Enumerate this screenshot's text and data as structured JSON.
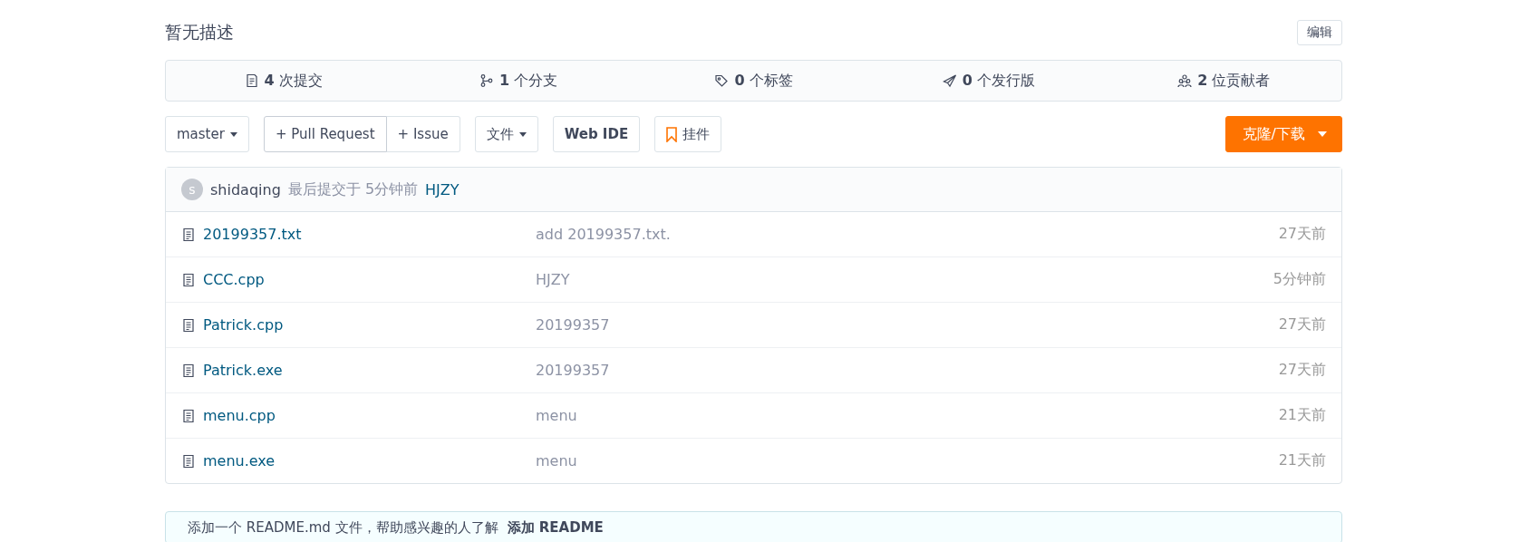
{
  "description": "暂无描述",
  "edit_button": "编辑",
  "stats": [
    {
      "kind": "commits",
      "count": "4",
      "label": "次提交"
    },
    {
      "kind": "branches",
      "count": "1",
      "label": "个分支"
    },
    {
      "kind": "tags",
      "count": "0",
      "label": "个标签"
    },
    {
      "kind": "releases",
      "count": "0",
      "label": "个发行版"
    },
    {
      "kind": "contributors",
      "count": "2",
      "label": "位贡献者"
    }
  ],
  "branch": "master",
  "pr_button": "+ Pull Request",
  "issue_button": "+ Issue",
  "file_menu": "文件",
  "web_ide": "Web IDE",
  "widget_button": "挂件",
  "clone_button": "克隆/下载",
  "last_commit": {
    "avatar": "s",
    "author": "shidaqing",
    "text": "最后提交于",
    "time": "5分钟前",
    "message": "HJZY"
  },
  "files": [
    {
      "name": "20199357.txt",
      "message": "add 20199357.txt.",
      "time": "27天前"
    },
    {
      "name": "CCC.cpp",
      "message": "HJZY",
      "time": "5分钟前"
    },
    {
      "name": "Patrick.cpp",
      "message": "20199357",
      "time": "27天前"
    },
    {
      "name": "Patrick.exe",
      "message": "20199357",
      "time": "27天前"
    },
    {
      "name": "menu.cpp",
      "message": "menu",
      "time": "21天前"
    },
    {
      "name": "menu.exe",
      "message": "menu",
      "time": "21天前"
    }
  ],
  "notice": {
    "text": "添加一个 README.md 文件，帮助感兴趣的人了解",
    "link": "添加 README"
  }
}
